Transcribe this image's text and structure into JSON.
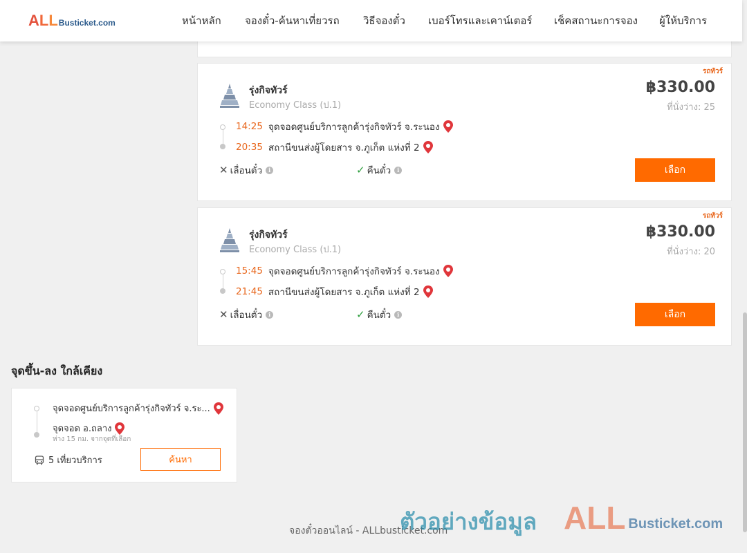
{
  "header": {
    "logo_all": "ALL",
    "logo_rest": "Busticket.com",
    "nav": [
      "หน้าหลัก",
      "จองตั๋ว-ค้นหาเที่ยวรถ",
      "วิธีจองตั๋ว",
      "เบอร์โทรและเคาน์เตอร์",
      "เช็คสถานะการจอง",
      "ผู้ให้บริการ"
    ]
  },
  "trips": [
    {
      "tag": "รถทัวร์",
      "operator": "รุ่งกิจทัวร์",
      "class": "Economy Class (ป.1)",
      "price": "฿330.00",
      "seats": "ที่นั่งว่าง: 25",
      "depart_time": "14:25",
      "depart_stop": "จุดจอดศูนย์บริการลูกค้ารุ่งกิจทัวร์ จ.ระนอง",
      "arrive_time": "20:35",
      "arrive_stop": "สถานีขนส่งผู้โดยสาร จ.ภูเก็ต แห่งที่ 2",
      "reschedule": "เลื่อนตั๋ว",
      "refund": "คืนตั๋ว",
      "select_label": "เลือก"
    },
    {
      "tag": "รถทัวร์",
      "operator": "รุ่งกิจทัวร์",
      "class": "Economy Class (ป.1)",
      "price": "฿330.00",
      "seats": "ที่นั่งว่าง: 20",
      "depart_time": "15:45",
      "depart_stop": "จุดจอดศูนย์บริการลูกค้ารุ่งกิจทัวร์ จ.ระนอง",
      "arrive_time": "21:45",
      "arrive_stop": "สถานีขนส่งผู้โดยสาร จ.ภูเก็ต แห่งที่ 2",
      "reschedule": "เลื่อนตั๋ว",
      "refund": "คืนตั๋ว",
      "select_label": "เลือก"
    }
  ],
  "nearby": {
    "title": "จุดขึ้น-ลง ใกล้เคียง",
    "from": "จุดจอดศูนย์บริการลูกค้ารุ่งกิจทัวร์ จ.ระ...",
    "to": "จุดจอด อ.ถลาง",
    "distance": "ห่าง 15 กม. จากจุดที่เลือก",
    "trips": "5 เที่ยวบริการ",
    "search_label": "ค้นหา"
  },
  "footer": {
    "text": "จองตั๋วออนไลน์ - ALLbusticket.com",
    "watermark_text": "ตัวอย่างข้อมูล",
    "watermark_logo_all": "ALL",
    "watermark_logo_rest": "Busticket.com"
  },
  "colors": {
    "accent": "#ff6a00",
    "time": "#e8651a",
    "pin": "#e0363b",
    "check": "#2e9e3e"
  }
}
